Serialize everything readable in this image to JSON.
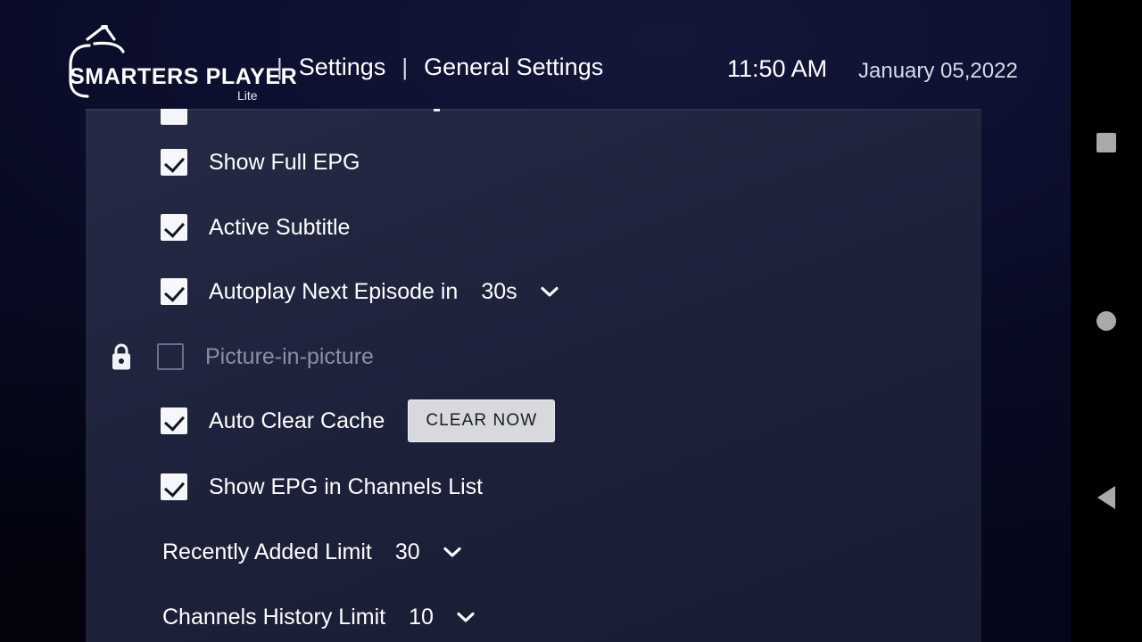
{
  "app": {
    "logo_name": "SMARTERS PLAYER",
    "logo_sub": "Lite",
    "logo_icon": "tv-antenna-icon"
  },
  "header": {
    "separator": "|",
    "breadcrumb_1": "Settings",
    "breadcrumb_2": "General Settings",
    "time": "11:50 AM",
    "date": "January 05,2022"
  },
  "settings": {
    "rows": [
      {
        "id": "show-full-epg",
        "label": "Show Full EPG",
        "checked": true
      },
      {
        "id": "active-subtitle",
        "label": "Active Subtitle",
        "checked": true
      },
      {
        "id": "autoplay-next",
        "label": "Autoplay Next Episode in",
        "checked": true,
        "value": "30s"
      },
      {
        "id": "picture-in-picture",
        "label": "Picture-in-picture",
        "checked": false,
        "locked": true
      },
      {
        "id": "auto-clear-cache",
        "label": "Auto Clear Cache",
        "checked": true,
        "button": "CLEAR NOW"
      },
      {
        "id": "show-epg-channels",
        "label": "Show EPG in Channels List",
        "checked": true
      },
      {
        "id": "recently-added-limit",
        "label": "Recently Added Limit",
        "value": "30"
      },
      {
        "id": "channels-history",
        "label": "Channels History Limit",
        "value": "10"
      }
    ]
  },
  "navbar": {
    "recents_icon": "square-icon",
    "home_icon": "circle-icon",
    "back_icon": "triangle-left-icon"
  },
  "colors": {
    "background": "#06071c",
    "panel": "#222741",
    "accent_text": "#ffffff",
    "dim_text": "#8a90a6",
    "button_bg": "#d7d9dd",
    "nav_icon": "#a9a9ad"
  }
}
